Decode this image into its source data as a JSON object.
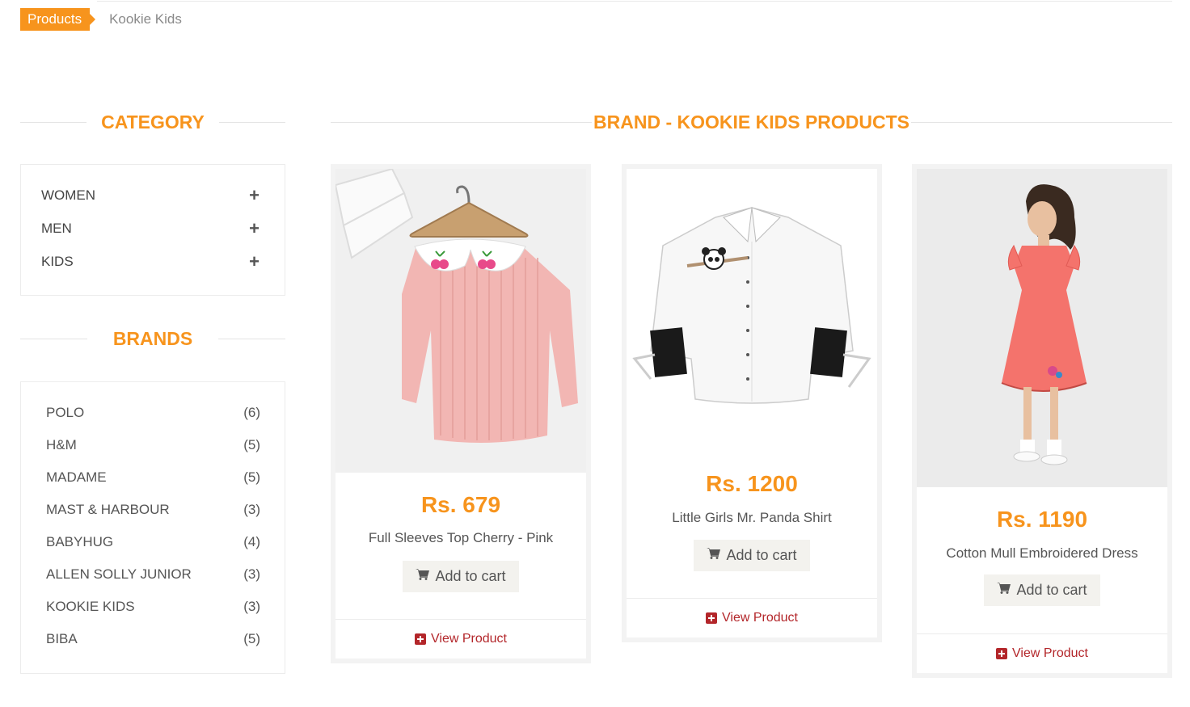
{
  "breadcrumb": {
    "root": "Products",
    "current": "Kookie Kids"
  },
  "sidebar": {
    "category_title": "CATEGORY",
    "categories": [
      {
        "label": "WOMEN",
        "icon": "plus-icon"
      },
      {
        "label": "MEN",
        "icon": "plus-icon"
      },
      {
        "label": "KIDS",
        "icon": "plus-icon"
      }
    ],
    "brands_title": "BRANDS",
    "brands": [
      {
        "label": "POLO",
        "count": "(6)"
      },
      {
        "label": "H&M",
        "count": "(5)"
      },
      {
        "label": "MADAME",
        "count": "(5)"
      },
      {
        "label": "MAST & HARBOUR",
        "count": "(3)"
      },
      {
        "label": "BABYHUG",
        "count": "(4)"
      },
      {
        "label": "ALLEN SOLLY JUNIOR",
        "count": "(3)"
      },
      {
        "label": "KOOKIE KIDS",
        "count": "(3)"
      },
      {
        "label": "BIBA",
        "count": "(5)"
      }
    ]
  },
  "main": {
    "title": "BRAND - KOOKIE KIDS PRODUCTS",
    "products": [
      {
        "price": "Rs. 679",
        "name": "Full Sleeves Top Cherry - Pink",
        "cart_label": "Add to cart",
        "view_label": "View Product",
        "image_icon": "pink-top-image"
      },
      {
        "price": "Rs. 1200",
        "name": "Little Girls Mr. Panda Shirt",
        "cart_label": "Add to cart",
        "view_label": "View Product",
        "image_icon": "panda-shirt-image"
      },
      {
        "price": "Rs. 1190",
        "name": "Cotton Mull Embroidered Dress",
        "cart_label": "Add to cart",
        "view_label": "View Product",
        "image_icon": "pink-dress-image"
      }
    ]
  },
  "colors": {
    "accent": "#f7941d",
    "link": "#b3262a",
    "button_bg": "#f3f2ee"
  }
}
